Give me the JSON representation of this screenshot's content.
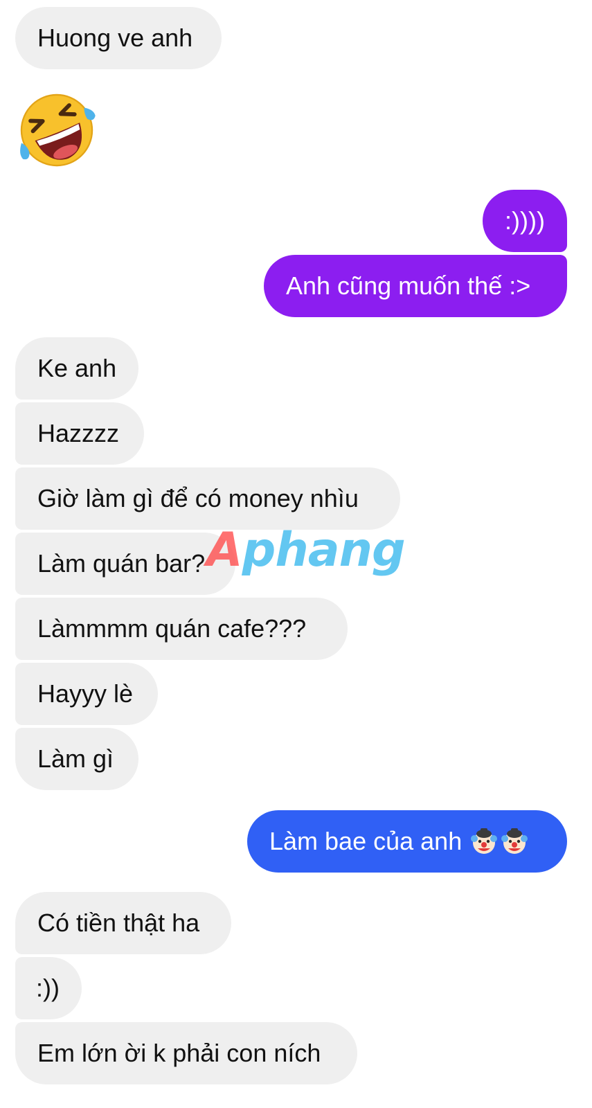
{
  "messages": [
    {
      "side": "in",
      "text": "Huong ve anh"
    },
    {
      "side": "in",
      "emoji": "rolling-on-floor-laughing-emoji"
    },
    {
      "side": "out",
      "text": ":))))"
    },
    {
      "side": "out",
      "text": "Anh cũng muốn thế :>"
    },
    {
      "side": "in",
      "text": "Ke anh"
    },
    {
      "side": "in",
      "text": "Hazzzz"
    },
    {
      "side": "in",
      "text": "Giờ làm gì để có money nhìu"
    },
    {
      "side": "in",
      "text": "Làm quán bar?"
    },
    {
      "side": "in",
      "text": "Làmmmm quán cafe???"
    },
    {
      "side": "in",
      "text": "Hayyy lè"
    },
    {
      "side": "in",
      "text": "Làm gì"
    },
    {
      "side": "out",
      "text": "Làm bae của anh",
      "emojis": [
        "clown-face-emoji",
        "clown-face-emoji"
      ]
    },
    {
      "side": "in",
      "text": "Có tiền thật ha"
    },
    {
      "side": "in",
      "text": ":))"
    },
    {
      "side": "in",
      "text": "Em lớn ời k phải con ních"
    }
  ],
  "watermark": {
    "first": "A",
    "rest": "phang"
  },
  "colors": {
    "incoming_bubble": "#efefef",
    "outgoing_purple": "#8c1ef0",
    "outgoing_blue": "#3060f5",
    "watermark_red": "#ff4a4a",
    "watermark_blue": "#38b8ee"
  }
}
